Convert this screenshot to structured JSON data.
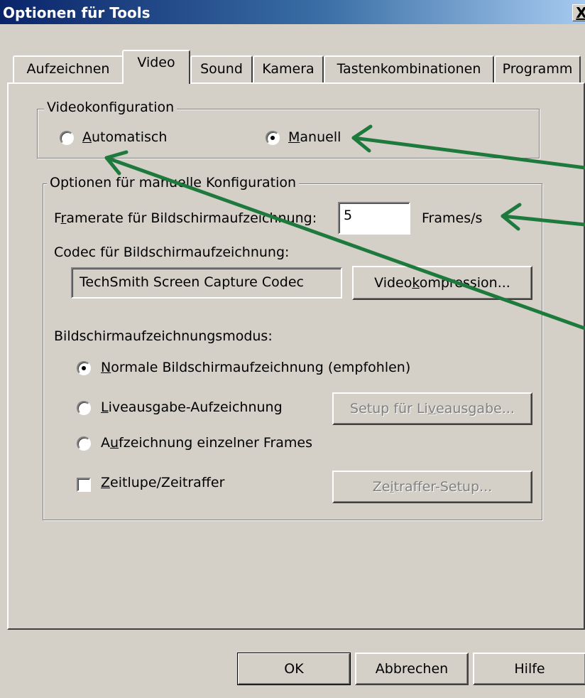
{
  "window": {
    "title": "Optionen für Tools",
    "close_label": "X"
  },
  "tabs": [
    {
      "label": "Aufzeichnen"
    },
    {
      "label": "Video"
    },
    {
      "label": "Sound"
    },
    {
      "label": "Kamera"
    },
    {
      "label": "Tastenkombinationen"
    },
    {
      "label": "Programm"
    }
  ],
  "videokonfiguration": {
    "legend": "Videokonfiguration",
    "automatisch": {
      "accel": "A",
      "rest": "utomatisch",
      "selected": false
    },
    "manuell": {
      "accel": "M",
      "rest": "anuell",
      "selected": true
    }
  },
  "manual": {
    "legend": "Optionen für manuelle Konfiguration",
    "framerate": {
      "pre": "F",
      "accel": "r",
      "post": "amerate für Bildschirmaufzeichnung:",
      "value": "5",
      "unit": "Frames/s"
    },
    "codec": {
      "label": "Codec für Bildschirmaufzeichnung:",
      "value": "TechSmith Screen Capture Codec"
    },
    "compression_button": {
      "pre": "Video",
      "accel": "k",
      "post": "ompression..."
    },
    "mode_label": "Bildschirmaufzeichnungsmodus:",
    "modes": [
      {
        "accel": "N",
        "rest": "ormale Bildschirmaufzeichnung (empfohlen)",
        "selected": true
      },
      {
        "accel": "L",
        "rest": "iveausgabe-Aufzeichnung",
        "selected": false
      },
      {
        "pre": "A",
        "accel": "u",
        "rest": "fzeichnung einzelner Frames",
        "selected": false
      }
    ],
    "live_setup_button": {
      "pre": "Setup für Li",
      "accel": "v",
      "post": "eausgabe..."
    },
    "zeitlupe": {
      "accel": "Z",
      "rest": "eitlupe/Zeitraffer",
      "checked": false
    },
    "zeitraffer_setup_button": {
      "pre": "Ze",
      "accel": "i",
      "post": "traffer-Setup..."
    }
  },
  "footer": {
    "ok": "OK",
    "cancel": "Abbrechen",
    "help": "Hilfe"
  },
  "colors": {
    "annotation_arrow": "#1e7a3c",
    "titlebar": "#0a246a",
    "face": "#d4d0c8"
  }
}
